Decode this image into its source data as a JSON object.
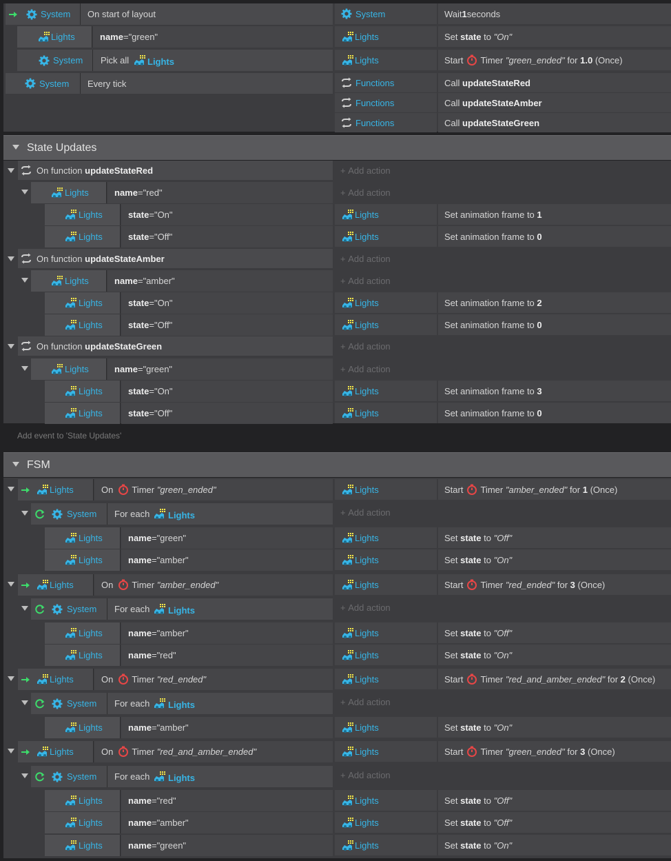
{
  "object_names": {
    "system": "System",
    "lights": "Lights",
    "functions": "Functions"
  },
  "words": {
    "name": "name",
    "state": "state",
    "equals": " = ",
    "set": "Set",
    "to": "to",
    "start": "Start",
    "timer": "Timer",
    "for": "for",
    "on": "On",
    "for_each": "For each",
    "call": "Call",
    "pick_all": "Pick all",
    "set_anim": "Set animation frame to",
    "on_function": "On function"
  },
  "top": {
    "e1_condition": "On start of layout",
    "e1_action": {
      "pre": "Wait ",
      "val": "1",
      "post": " seconds"
    },
    "e1_sub_value": "\"green\"",
    "e1_sub_action_value": "\"On\"",
    "e1_sub2_action": {
      "timer": "\"green_ended\"",
      "val": "1.0",
      "post": "(Once)"
    },
    "e2_condition": "Every tick",
    "calls": [
      "updateStateRed",
      "updateStateAmber",
      "updateStateGreen"
    ]
  },
  "groups": {
    "state_updates": {
      "title": "State Updates",
      "add_event": "Add event to 'State Updates'"
    },
    "fsm": {
      "title": "FSM"
    }
  },
  "add_action": "Add action",
  "state_updates": {
    "fn_red": "updateStateRed",
    "fn_amber": "updateStateAmber",
    "fn_green": "updateStateGreen",
    "red": "\"red\"",
    "amber": "\"amber\"",
    "green": "\"green\"",
    "on": "\"On\"",
    "off": "\"Off\"",
    "frames": [
      "1",
      "0",
      "2",
      "0",
      "3",
      "0"
    ]
  },
  "fsm": {
    "t_green": "\"green_ended\"",
    "t_amber": "\"amber_ended\"",
    "t_red": "\"red_ended\"",
    "t_ra": "\"red_and_amber_ended\"",
    "start1": {
      "val": "1",
      "post": "(Once)"
    },
    "start2": {
      "val": "3",
      "post": "(Once)"
    },
    "start3": {
      "val": "2",
      "post": "(Once)"
    },
    "start4": {
      "val": "3",
      "post": "(Once)"
    },
    "v_green": "\"green\"",
    "v_amber": "\"amber\"",
    "v_red": "\"red\"",
    "v_on": "\"On\"",
    "v_off": "\"Off\""
  },
  "colors": {
    "object_text": "#37b5e6",
    "background": "#222224",
    "row": "#454548"
  }
}
